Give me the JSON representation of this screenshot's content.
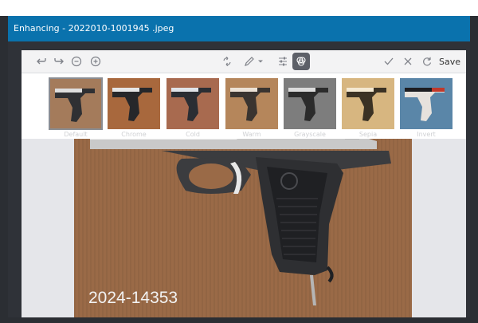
{
  "window": {
    "title": "Enhancing - 2022010-1001945 .jpeg"
  },
  "toolbar": {
    "save_label": "Save"
  },
  "filters": [
    {
      "label": "Default",
      "tint": "#a47b5b",
      "selected": true
    },
    {
      "label": "Chrome",
      "tint": "#a8683d",
      "selected": false
    },
    {
      "label": "Cold",
      "tint": "#a86a4f",
      "selected": false
    },
    {
      "label": "Warm",
      "tint": "#b5865b",
      "selected": false
    },
    {
      "label": "Grayscale",
      "tint": "#7d7d7d",
      "selected": false
    },
    {
      "label": "Sepia",
      "tint": "#d7b680",
      "selected": false
    },
    {
      "label": "Invert",
      "tint": "#5a86a8",
      "selected": false
    }
  ],
  "photo": {
    "caption": "2024-14353"
  },
  "colors": {
    "titlebar": "#0a72ad",
    "background": "#2b2e33"
  }
}
